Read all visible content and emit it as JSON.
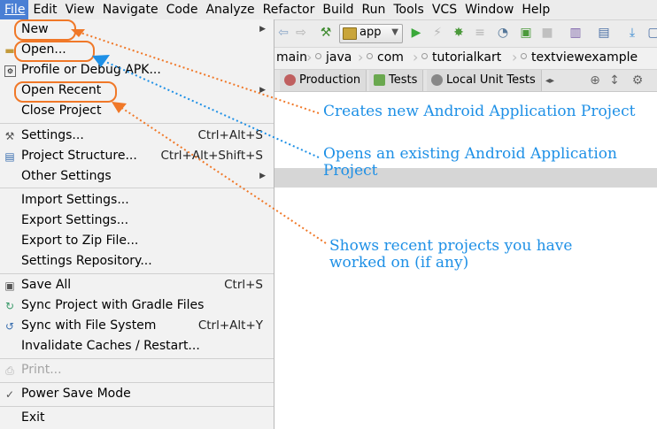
{
  "menubar": {
    "items": [
      {
        "label": "File",
        "active": true
      },
      {
        "label": "Edit"
      },
      {
        "label": "View"
      },
      {
        "label": "Navigate"
      },
      {
        "label": "Code"
      },
      {
        "label": "Analyze"
      },
      {
        "label": "Refactor"
      },
      {
        "label": "Build"
      },
      {
        "label": "Run"
      },
      {
        "label": "Tools"
      },
      {
        "label": "VCS"
      },
      {
        "label": "Window"
      },
      {
        "label": "Help"
      }
    ]
  },
  "toolbar": {
    "run_config": "app",
    "icons": [
      "back-arrow-icon",
      "forward-arrow-icon",
      "hammer-icon",
      "run-icon",
      "apply-changes-icon",
      "debug-icon",
      "attach-debugger-icon",
      "profile-icon",
      "coverage-icon",
      "stop-icon",
      "sync-icon",
      "avd-manager-icon",
      "sdk-manager-icon"
    ]
  },
  "breadcrumb": {
    "items": [
      "main",
      "java",
      "com",
      "tutorialkart",
      "textviewexample"
    ]
  },
  "tabs": {
    "items": [
      "Production",
      "Tests",
      "Local Unit Tests"
    ]
  },
  "file_menu": {
    "items": [
      {
        "label": "New",
        "submenu": true
      },
      {
        "label": "Open..."
      },
      {
        "label": "Profile or Debug APK..."
      },
      {
        "label": "Open Recent",
        "submenu": true
      },
      {
        "label": "Close Project"
      },
      {
        "label": "Settings...",
        "shortcut": "Ctrl+Alt+S"
      },
      {
        "label": "Project Structure...",
        "shortcut": "Ctrl+Alt+Shift+S"
      },
      {
        "label": "Other Settings",
        "submenu": true
      },
      {
        "label": "Import Settings..."
      },
      {
        "label": "Export Settings..."
      },
      {
        "label": "Export to Zip File..."
      },
      {
        "label": "Settings Repository..."
      },
      {
        "label": "Save All",
        "shortcut": "Ctrl+S"
      },
      {
        "label": "Sync Project with Gradle Files"
      },
      {
        "label": "Sync with File System",
        "shortcut": "Ctrl+Alt+Y"
      },
      {
        "label": "Invalidate Caches / Restart..."
      },
      {
        "label": "Print...",
        "disabled": true
      },
      {
        "label": "Power Save Mode",
        "checked": true
      },
      {
        "label": "Exit"
      }
    ]
  },
  "annotations": {
    "new": "Creates new Android Application Project",
    "open_line1": "Opens an existing Android Application",
    "open_line2": "Project",
    "recent_line1": "Shows recent projects you have",
    "recent_line2": "worked on (if any)"
  },
  "colors": {
    "highlight_oval": "#f07828",
    "note_text": "#1e90e6",
    "menubar_active": "#4a7fd4"
  }
}
